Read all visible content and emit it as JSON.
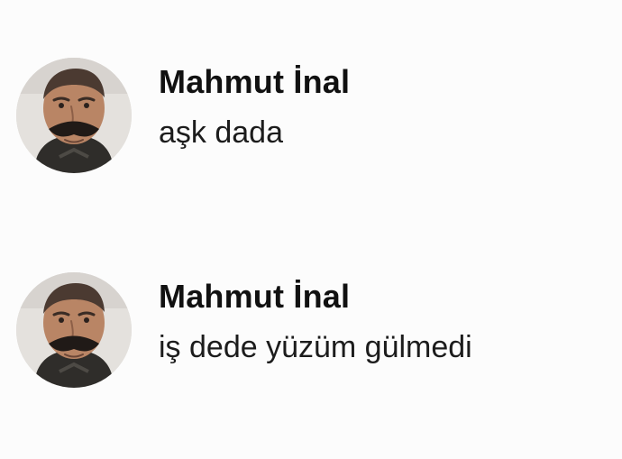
{
  "posts": [
    {
      "author": "Mahmut İnal",
      "text": "aşk dada",
      "avatar_icon": "profile-photo-icon"
    },
    {
      "author": "Mahmut İnal",
      "text": "iş dede yüzüm gülmedi",
      "avatar_icon": "profile-photo-icon"
    }
  ],
  "colors": {
    "background": "#fcfcfc",
    "text": "#141414"
  }
}
